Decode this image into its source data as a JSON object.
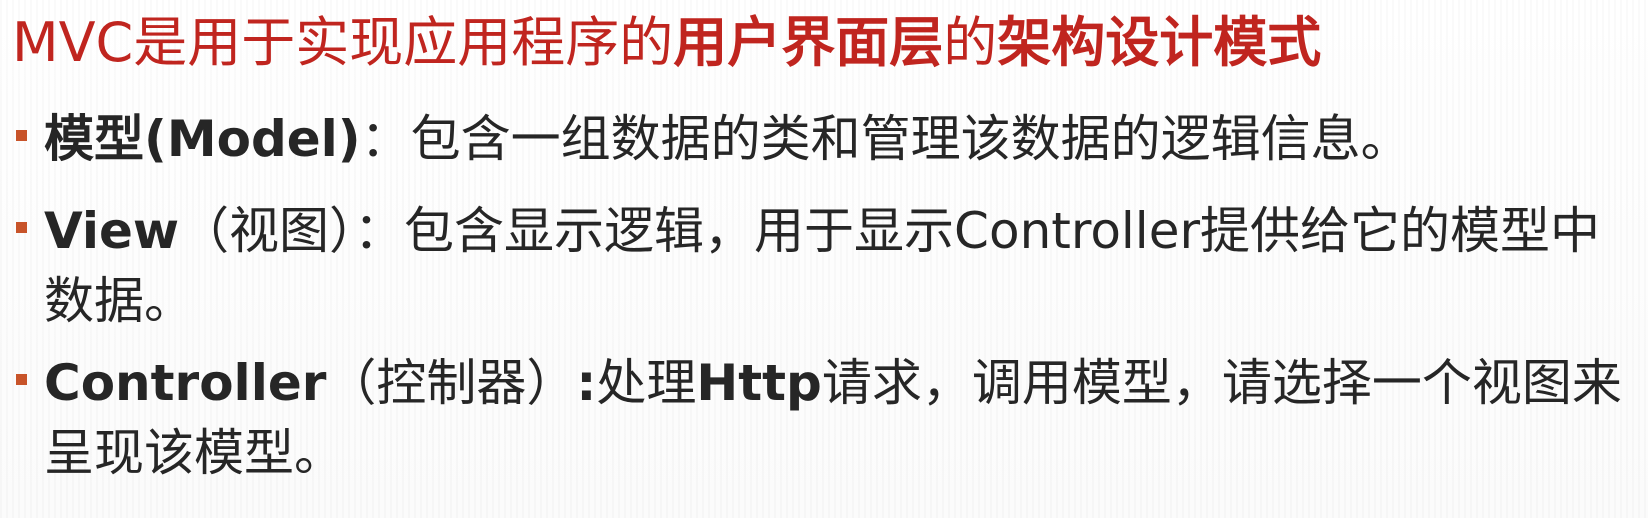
{
  "title": {
    "part1": "MVC是用于实现应用程序的",
    "part2": "用户界面层",
    "part3": "的",
    "part4": "架构设计模式"
  },
  "bullets": [
    {
      "bold": "模型(Model)",
      "text": "：包含一组数据的类和管理该数据的逻辑信息。"
    },
    {
      "bold": "View",
      "text": "（视图）：包含显示逻辑，用于显示Controller提供给它的模型中数据。"
    },
    {
      "bold": "Controller",
      "text_a": "（控制器）",
      "bold_b": ":",
      "text_b": "处理",
      "bold_c": "Http",
      "text_c": "请求，调用模型，请选择一个视图来呈现该模型。"
    }
  ],
  "colors": {
    "title": "#c0251f",
    "bullet_marker": "#c8542a",
    "body_text": "#262626"
  }
}
